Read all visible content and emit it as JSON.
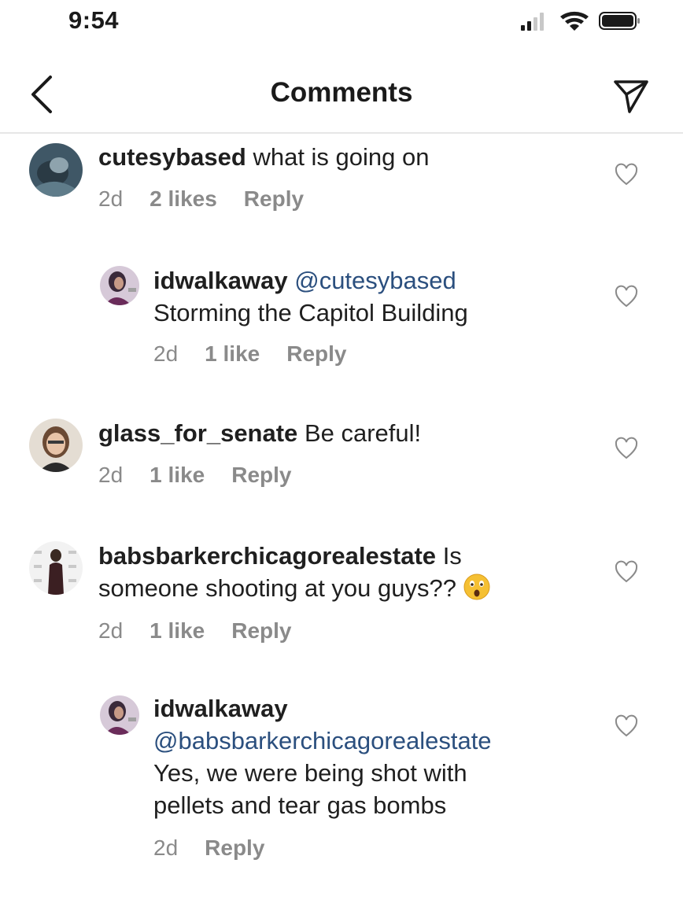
{
  "status_bar": {
    "time": "9:54"
  },
  "header": {
    "title": "Comments"
  },
  "comments": [
    {
      "username": "cutesybased",
      "text": "what is going on",
      "time": "2d",
      "likes": "2 likes",
      "reply_label": "Reply"
    },
    {
      "username": "idwalkaway",
      "mention": "@cutesybased",
      "text": "Storming the Capitol Building",
      "time": "2d",
      "likes": "1 like",
      "reply_label": "Reply"
    },
    {
      "username": "glass_for_senate",
      "text": "Be careful!",
      "time": "2d",
      "likes": "1 like",
      "reply_label": "Reply"
    },
    {
      "username": "babsbarkerchicagorealestate",
      "text_line1": "Is",
      "text_line2": "someone shooting at you guys??",
      "emoji": "astonished-face",
      "time": "2d",
      "likes": "1 like",
      "reply_label": "Reply"
    },
    {
      "username": "idwalkaway",
      "mention": "@babsbarkerchicagorealestate",
      "text_line1": "Yes, we were being shot with",
      "text_line2": "pellets and tear gas bombs",
      "time": "2d",
      "reply_label": "Reply"
    }
  ],
  "icons": {
    "back": "chevron-left-icon",
    "share": "paper-plane-icon",
    "like": "heart-outline-icon"
  },
  "colors": {
    "mention": "#2b4f7e",
    "meta_text": "#8a8a8a",
    "divider": "#e6e6e6"
  }
}
